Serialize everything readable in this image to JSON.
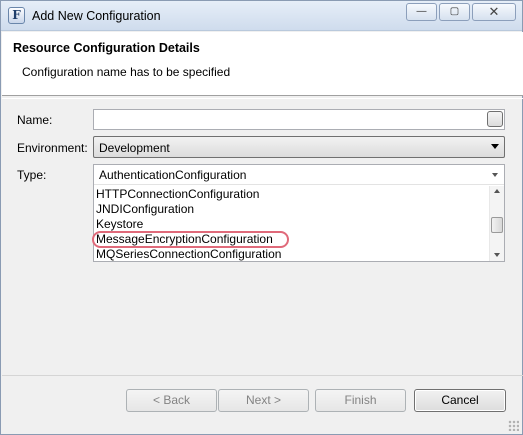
{
  "window": {
    "title": "Add New Configuration",
    "app_icon_glyph": "F",
    "controls": {
      "minimize": "—",
      "maximize": "▢",
      "close": "✕"
    }
  },
  "header": {
    "title": "Resource Configuration Details",
    "message": "Configuration name has to be specified"
  },
  "form": {
    "name": {
      "label": "Name:",
      "value": ""
    },
    "environment": {
      "label": "Environment:",
      "selected": "Development"
    },
    "type": {
      "label": "Type:",
      "selected": "AuthenticationConfiguration",
      "options": [
        "HTTPConnectionConfiguration",
        "JNDIConfiguration",
        "Keystore",
        "MessageEncryptionConfiguration",
        "MQSeriesConnectionConfiguration"
      ],
      "highlighted_option": "MessageEncryptionConfiguration"
    }
  },
  "buttons": {
    "back": "< Back",
    "next": "Next >",
    "finish": "Finish",
    "cancel": "Cancel"
  },
  "colors": {
    "highlight_outline": "#e06a7a",
    "disabled_text": "#838383",
    "titlebar": "#dbe5f2"
  }
}
